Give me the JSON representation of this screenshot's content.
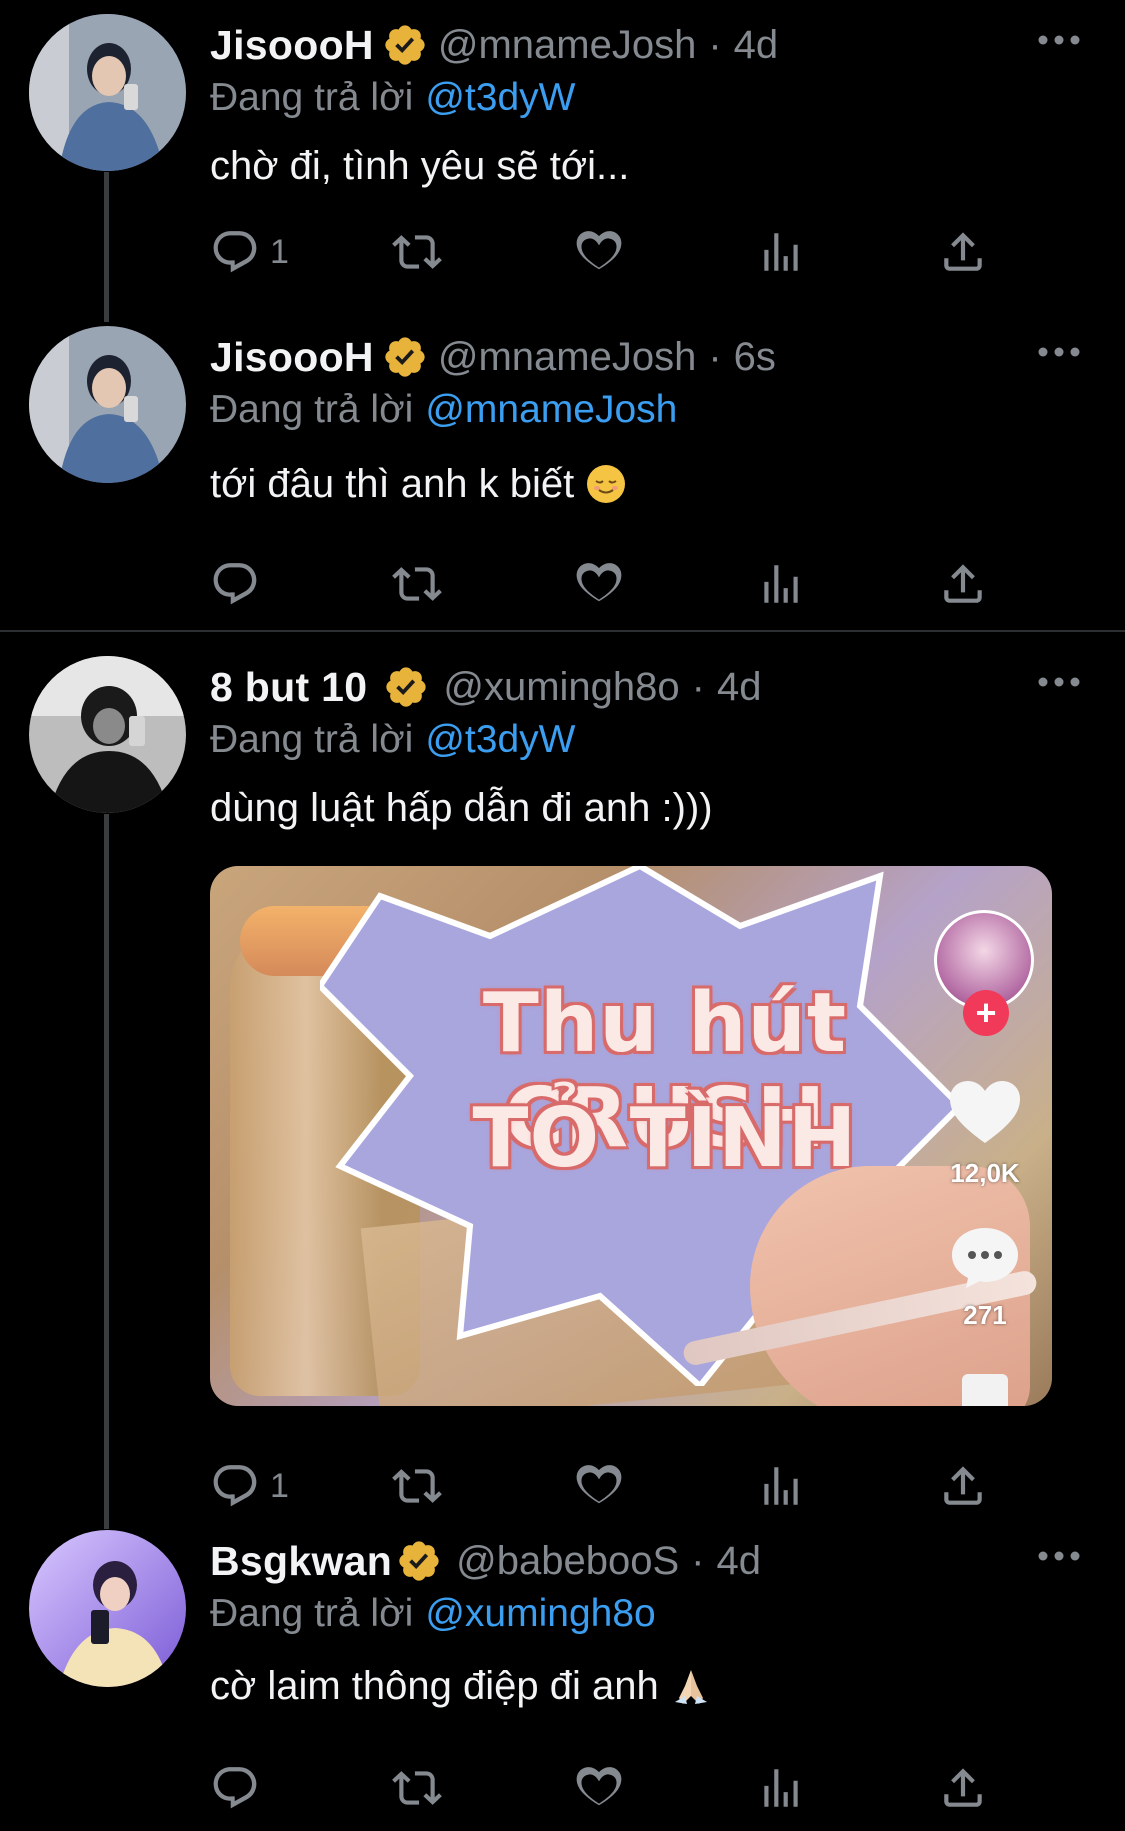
{
  "tweets": [
    {
      "name": "JisoooH",
      "handle": "@mnameJosh",
      "time": "4d",
      "reply_prefix": "Đang trả lời",
      "reply_to": "@t3dyW",
      "text": "chờ đi, tình yêu sẽ tới...",
      "reply_count": "1",
      "avatar_colors": [
        "#7d98c4",
        "#3d4c68"
      ]
    },
    {
      "name": "JisoooH",
      "handle": "@mnameJosh",
      "time": "6s",
      "reply_prefix": "Đang trả lời",
      "reply_to": "@mnameJosh",
      "text": "tới đâu thì anh k biết",
      "reply_count": "",
      "avatar_colors": [
        "#7d98c4",
        "#3d4c68"
      ]
    },
    {
      "name": "8 but 10",
      "handle": "@xumingh8o",
      "time": "4d",
      "reply_prefix": "Đang trả lời",
      "reply_to": "@t3dyW",
      "text": "dùng luật hấp dẫn đi anh :)))",
      "reply_count": "1",
      "avatar_colors": [
        "#777777",
        "#111111"
      ],
      "media": {
        "title_line1": "Thu hút CRUSH",
        "title_line2": "TỎ TÌNH",
        "likes": "12,0K",
        "comments": "271"
      }
    },
    {
      "name": "Bsgkwan",
      "handle": "@babebooS",
      "time": "4d",
      "reply_prefix": "Đang trả lời",
      "reply_to": "@xumingh8o",
      "text": "cờ laim thông điệp đi anh",
      "reply_count": "",
      "avatar_colors": [
        "#b9a7ff",
        "#6d4fb8"
      ]
    }
  ],
  "separator": "·",
  "icons": [
    "reply-icon",
    "retweet-icon",
    "like-icon",
    "views-icon",
    "share-icon",
    "more-icon",
    "verified-badge-icon"
  ],
  "colors": {
    "background": "#000000",
    "text": "#f2f3f4",
    "muted": "#858a90",
    "link": "#3b9ef0",
    "badge": "#e8b33a"
  }
}
